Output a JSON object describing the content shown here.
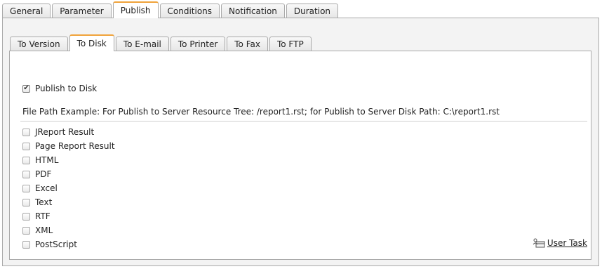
{
  "outer_tabs": [
    "General",
    "Parameter",
    "Publish",
    "Conditions",
    "Notification",
    "Duration"
  ],
  "outer_active_tab": "Publish",
  "inner_tabs": [
    "To Version",
    "To Disk",
    "To E-mail",
    "To Printer",
    "To Fax",
    "To FTP"
  ],
  "inner_active_tab": "To Disk",
  "publish_to_disk": {
    "label": "Publish to Disk",
    "checked": true
  },
  "file_path_example": "File Path Example: For Publish to Server Resource Tree: /report1.rst; for Publish to Server Disk Path: C:\\report1.rst",
  "formats": [
    {
      "label": "JReport Result",
      "checked": false
    },
    {
      "label": "Page Report Result",
      "checked": false
    },
    {
      "label": "HTML",
      "checked": false
    },
    {
      "label": "PDF",
      "checked": false
    },
    {
      "label": "Excel",
      "checked": false
    },
    {
      "label": "Text",
      "checked": false
    },
    {
      "label": "RTF",
      "checked": false
    },
    {
      "label": "XML",
      "checked": false
    },
    {
      "label": "PostScript",
      "checked": false
    }
  ],
  "user_task": {
    "label": "User Task",
    "icon": "user-task-icon"
  },
  "colors": {
    "active_tab_accent": "#f0a33a",
    "panel_background": "#f3f3f3",
    "border": "#a9a9a9"
  }
}
